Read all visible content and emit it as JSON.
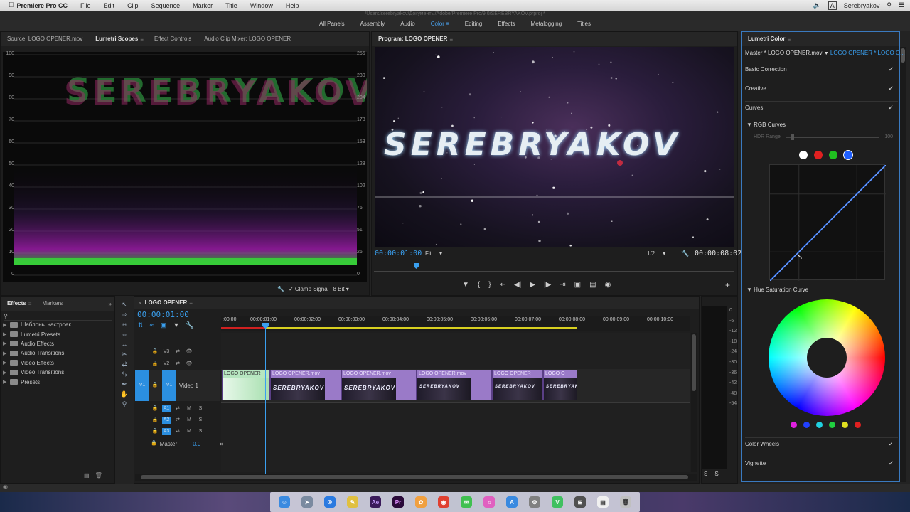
{
  "menubar": {
    "apple": "",
    "app": "Premiere Pro CC",
    "items": [
      "File",
      "Edit",
      "Clip",
      "Sequence",
      "Marker",
      "Title",
      "Window",
      "Help"
    ],
    "user": "Serebryakov"
  },
  "workspace": {
    "path": "/Users/serebryakov/Документы/Adobe/Premiere Pro/9.0/SEREBRYAKOV.prproj *",
    "tabs": [
      "All Panels",
      "Assembly",
      "Audio",
      "Color",
      "Editing",
      "Effects",
      "Metalogging",
      "Titles"
    ],
    "active": "Color"
  },
  "source_panel": {
    "tabs": [
      "Source: LOGO OPENER.mov",
      "Lumetri Scopes",
      "Effect Controls",
      "Audio Clip Mixer: LOGO OPENER"
    ],
    "active": "Lumetri Scopes",
    "scope_left_ticks": [
      "100",
      "90",
      "80",
      "70",
      "60",
      "50",
      "40",
      "30",
      "20",
      "10",
      "0"
    ],
    "scope_right_ticks": [
      "255",
      "230",
      "204",
      "178",
      "153",
      "128",
      "102",
      "76",
      "51",
      "26",
      "0"
    ],
    "scope_text": "SEREBRYAKOV",
    "clamp_label": "Clamp Signal",
    "bit_depth": "8 Bit"
  },
  "program": {
    "title": "Program: LOGO OPENER",
    "frame_text": "SEREBRYAKOV",
    "timecode": "00:00:01:00",
    "fit": "Fit",
    "resolution": "1/2",
    "duration": "00:00:08:02"
  },
  "effects_panel": {
    "tabs": [
      "Effects",
      "Markers"
    ],
    "search_placeholder": "",
    "items": [
      "Шаблоны настроек",
      "Lumetri Presets",
      "Audio Effects",
      "Audio Transitions",
      "Video Effects",
      "Video Transitions",
      "Presets"
    ]
  },
  "timeline": {
    "title": "LOGO OPENER",
    "timecode": "00:00:01:00",
    "ruler": [
      ":00:00",
      "00:00:01:00",
      "00:00:02:00",
      "00:00:03:00",
      "00:00:04:00",
      "00:00:05:00",
      "00:00:06:00",
      "00:00:07:00",
      "00:00:08:00",
      "00:00:09:00",
      "00:00:10:00"
    ],
    "tracks": [
      {
        "name": "V3",
        "label": ""
      },
      {
        "name": "V2",
        "label": ""
      },
      {
        "name": "V1",
        "label": "Video 1"
      },
      {
        "name": "A1",
        "label": ""
      },
      {
        "name": "A2",
        "label": ""
      },
      {
        "name": "A3",
        "label": ""
      }
    ],
    "master_label": "Master",
    "master_value": "0.0",
    "clips": [
      "LOGO OPENER",
      "LOGO OPENER.mov",
      "LOGO OPENER.mov",
      "LOGO OPENER.mov",
      "LOGO OPENER",
      "LOGO O"
    ],
    "clip_thumb_text": "SEREBRYAKOV"
  },
  "meters": {
    "ticks": [
      "0",
      "-6",
      "-12",
      "-18",
      "-24",
      "-30",
      "-36",
      "-42",
      "-48",
      "-54"
    ],
    "solo": [
      "S",
      "S"
    ]
  },
  "lumetri": {
    "title": "Lumetri Color",
    "master_label": "Master * LOGO OPENER.mov",
    "seq_label": "LOGO OPENER * LOGO O...",
    "sections": [
      "Basic Correction",
      "Creative",
      "Curves"
    ],
    "rgb_curves": "RGB Curves",
    "hdr_label": "HDR Range",
    "hdr_value": "100",
    "hue_sat": "Hue Saturation Curve",
    "bottom_sections": [
      "Color Wheels",
      "Vignette"
    ],
    "check": "✓",
    "curve_colors": [
      "#ffffff",
      "#e02020",
      "#20c020",
      "#2060ff"
    ],
    "hue_dot_colors": [
      "#e020e0",
      "#2040ff",
      "#20d0e0",
      "#20d040",
      "#e0e020",
      "#e02020"
    ]
  },
  "dock": {
    "items": [
      "Finder",
      "Launchpad",
      "Safari",
      "Notes",
      "Ae",
      "Pr",
      "Photos",
      "Chrome",
      "Messages",
      "iTunes",
      "App Store",
      "Settings",
      "Vine",
      "Calculator",
      "Notes2",
      "Trash"
    ]
  }
}
